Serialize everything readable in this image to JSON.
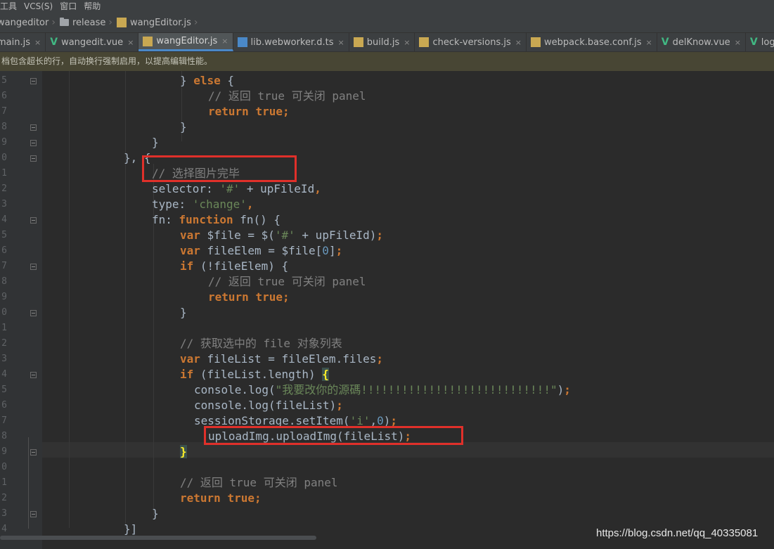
{
  "menu": [
    "工具",
    "VCS(S)",
    "窗口",
    "帮助"
  ],
  "breadcrumb": [
    "wangeditor",
    "release",
    "wangEditor.js"
  ],
  "tabs": [
    {
      "label": "main.js",
      "type": "js",
      "active": false,
      "close": "×"
    },
    {
      "label": "wangedit.vue",
      "type": "vue",
      "active": false,
      "close": "×"
    },
    {
      "label": "wangEditor.js",
      "type": "js",
      "active": true,
      "close": "×"
    },
    {
      "label": "lib.webworker.d.ts",
      "type": "ts",
      "active": false,
      "close": "×"
    },
    {
      "label": "build.js",
      "type": "js",
      "active": false,
      "close": "×"
    },
    {
      "label": "check-versions.js",
      "type": "js",
      "active": false,
      "close": "×"
    },
    {
      "label": "webpack.base.conf.js",
      "type": "js",
      "active": false,
      "close": "×"
    },
    {
      "label": "delKnow.vue",
      "type": "vue",
      "active": false,
      "close": "×"
    },
    {
      "label": "login_warp.vue",
      "type": "vue",
      "active": false,
      "close": "×"
    }
  ],
  "notice": "档包含超长的行，自动换行强制启用，以提高编辑性能。",
  "line_numbers": [
    "5",
    "6",
    "7",
    "8",
    "9",
    "0",
    "1",
    "2",
    "3",
    "4",
    "5",
    "6",
    "7",
    "8",
    "9",
    "0",
    "1",
    "2",
    "3",
    "4",
    "5",
    "6",
    "7",
    "8",
    "9",
    "0",
    "1",
    "2",
    "3",
    "4"
  ],
  "code_lines": [
    [
      {
        "t": "} "
      },
      {
        "t": "else",
        "c": "kw"
      },
      {
        "t": " {"
      }
    ],
    [
      {
        "t": "// 返回 true 可关闭 panel",
        "c": "cmt"
      }
    ],
    [
      {
        "t": "return",
        "c": "kw"
      },
      {
        "t": " "
      },
      {
        "t": "true",
        "c": "kw"
      },
      {
        "t": ";",
        "c": "kw"
      }
    ],
    [
      {
        "t": "}"
      }
    ],
    [
      {
        "t": "}"
      }
    ],
    [
      {
        "t": "}, {"
      }
    ],
    [
      {
        "t": "// 选择图片完毕",
        "c": "cmt"
      }
    ],
    [
      {
        "t": "selector: "
      },
      {
        "t": "'#'",
        "c": "str"
      },
      {
        "t": " + upFileId"
      },
      {
        "t": ",",
        "c": "kw"
      }
    ],
    [
      {
        "t": "type: "
      },
      {
        "t": "'change'",
        "c": "str"
      },
      {
        "t": ",",
        "c": "kw"
      }
    ],
    [
      {
        "t": "fn: "
      },
      {
        "t": "function",
        "c": "kw"
      },
      {
        "t": " fn() {"
      }
    ],
    [
      {
        "t": "var",
        "c": "kw"
      },
      {
        "t": " $file = $("
      },
      {
        "t": "'#'",
        "c": "str"
      },
      {
        "t": " + upFileId)"
      },
      {
        "t": ";",
        "c": "kw"
      }
    ],
    [
      {
        "t": "var",
        "c": "kw"
      },
      {
        "t": " fileElem = $file["
      },
      {
        "t": "0",
        "c": "num"
      },
      {
        "t": "]"
      },
      {
        "t": ";",
        "c": "kw"
      }
    ],
    [
      {
        "t": "if",
        "c": "kw"
      },
      {
        "t": " (!fileElem) {"
      }
    ],
    [
      {
        "t": "// 返回 true 可关闭 panel",
        "c": "cmt"
      }
    ],
    [
      {
        "t": "return",
        "c": "kw"
      },
      {
        "t": " "
      },
      {
        "t": "true",
        "c": "kw"
      },
      {
        "t": ";",
        "c": "kw"
      }
    ],
    [
      {
        "t": "}"
      }
    ],
    [],
    [
      {
        "t": "// 获取选中的 file 对象列表",
        "c": "cmt"
      }
    ],
    [
      {
        "t": "var",
        "c": "kw"
      },
      {
        "t": " fileList = fileElem.files"
      },
      {
        "t": ";",
        "c": "kw"
      }
    ],
    [
      {
        "t": "if",
        "c": "kw"
      },
      {
        "t": " (fileList.length) "
      },
      {
        "t": "{",
        "c": "brace-hl"
      }
    ],
    [
      {
        "t": "console.log("
      },
      {
        "t": "\"我要改你的源碼!!!!!!!!!!!!!!!!!!!!!!!!!!!!\"",
        "c": "str"
      },
      {
        "t": ")"
      },
      {
        "t": ";",
        "c": "kw"
      }
    ],
    [
      {
        "t": "console.log(fileList)"
      },
      {
        "t": ";",
        "c": "kw"
      }
    ],
    [
      {
        "t": "sessionStorage.setItem("
      },
      {
        "t": "'i'",
        "c": "str"
      },
      {
        "t": ","
      },
      {
        "t": "0",
        "c": "num"
      },
      {
        "t": ")"
      },
      {
        "t": ";",
        "c": "kw"
      }
    ],
    [
      {
        "t": "uploadImg.uploadImg(fileList)"
      },
      {
        "t": ";",
        "c": "kw"
      }
    ],
    [
      {
        "t": "}",
        "c": "brace-hl"
      }
    ],
    [],
    [
      {
        "t": "// 返回 true 可关闭 panel",
        "c": "cmt"
      }
    ],
    [
      {
        "t": "return",
        "c": "kw"
      },
      {
        "t": " "
      },
      {
        "t": "true",
        "c": "kw"
      },
      {
        "t": ";",
        "c": "kw"
      }
    ],
    [
      {
        "t": "}"
      }
    ],
    [
      {
        "t": "}]"
      }
    ]
  ],
  "colors": {
    "keyword": "#cc7832",
    "string": "#6a8759",
    "number": "#6897bb",
    "comment": "#808080",
    "text": "#a9b7c6",
    "highlight_box": "#e0302a"
  },
  "watermark": "https://blog.csdn.net/qq_40335081"
}
